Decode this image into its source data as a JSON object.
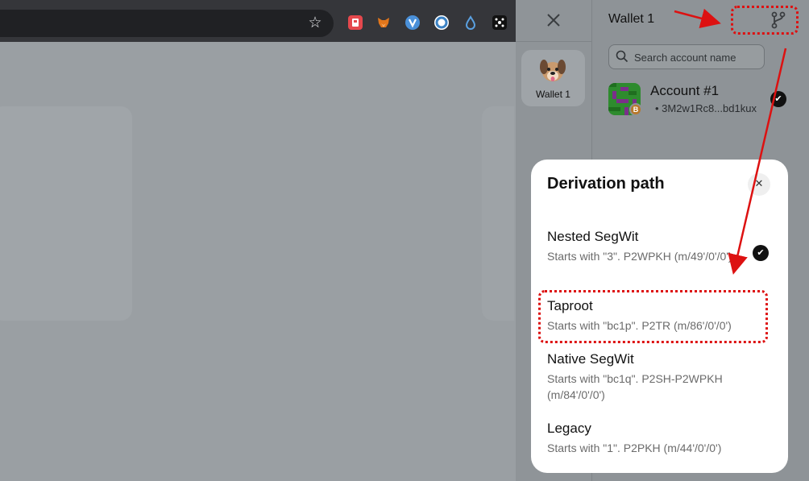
{
  "browser": {
    "bookmark_icon": "star-icon",
    "extensions": [
      {
        "name": "extension-red-icon",
        "color": "#e5484d"
      },
      {
        "name": "metamask-fox-icon",
        "color": "#e2761b"
      },
      {
        "name": "extension-blue-v-icon",
        "color": "#4a90d9"
      },
      {
        "name": "extension-ring-icon",
        "color": "#3b82c4"
      },
      {
        "name": "extension-drop-icon",
        "color": "#5aa0e0"
      },
      {
        "name": "extension-dark-icon",
        "color": "#111111"
      }
    ]
  },
  "sidebar": {
    "close_icon": "close-icon",
    "wallet_label": "Wallet 1",
    "wallet_avatar": "dog-avatar"
  },
  "header": {
    "title": "Wallet 1",
    "derivation_icon": "branch-icon"
  },
  "search": {
    "placeholder": "Search account name"
  },
  "accounts": [
    {
      "name": "Account #1",
      "address": "• 3M2w1Rc8...bd1kux",
      "chain_badge": "B",
      "selected": true
    }
  ],
  "modal": {
    "title": "Derivation path",
    "close_label": "✕",
    "options": [
      {
        "name": "Nested SegWit",
        "desc": "Starts with \"3\". P2WPKH (m/49'/0'/0')",
        "selected": true
      },
      {
        "name": "Taproot",
        "desc": "Starts with \"bc1p\". P2TR (m/86'/0'/0')",
        "selected": false
      },
      {
        "name": "Native SegWit",
        "desc": "Starts with \"bc1q\". P2SH-P2WPKH (m/84'/0'/0')",
        "selected": false
      },
      {
        "name": "Legacy",
        "desc": "Starts with \"1\". P2PKH (m/44'/0'/0')",
        "selected": false
      }
    ]
  },
  "colors": {
    "annotation": "#dd1111",
    "check_bg": "#111111",
    "btc": "#b8782a"
  }
}
